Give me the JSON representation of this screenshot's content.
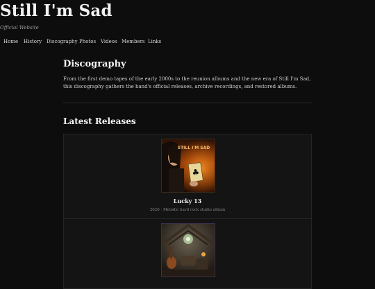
{
  "site": {
    "title": "Still I'm Sad",
    "tagline": "Official Website"
  },
  "nav": {
    "items": [
      "Home",
      "History",
      "Discography",
      "Photos",
      "Videos",
      "Members",
      "Links"
    ]
  },
  "page": {
    "heading": "Discography",
    "intro": "From the first demo tapes of the early 2000s to the reunion albums and the new era of Still I'm Sad, this discography gathers the band's official releases, archive recordings, and restored albums.",
    "section_heading": "Latest Releases"
  },
  "releases": [
    {
      "title": "Lucky 13",
      "meta": "2026 · Melodic hard rock studio album",
      "cover_text": "STILL I'M SAD",
      "cover_icon": "club-card-icon"
    },
    {
      "title": "",
      "meta": "",
      "cover_icon": "attic-still-life-icon"
    }
  ]
}
